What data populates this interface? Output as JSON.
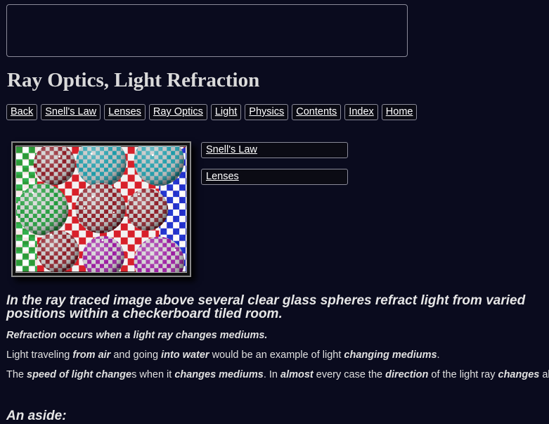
{
  "title": "Ray Optics, Light Refraction",
  "nav": [
    "Back",
    "Snell's Law",
    "Lenses",
    "Ray Optics",
    "Light",
    "Physics",
    "Contents",
    "Index",
    "Home"
  ],
  "side_links": [
    "Snell's Law",
    "Lenses"
  ],
  "caption": "In the ray traced image above several clear glass spheres refract light from varied positions within a checkerboard tiled room.",
  "p1": "Refraction occurs when a light ray changes mediums.",
  "p2": {
    "t1": "Light traveling ",
    "b1": "from air",
    "t2": " and going ",
    "b2": "into water",
    "t3": " would be an example of light ",
    "b3": "changing mediums",
    "t4": "."
  },
  "p3": {
    "t1": "The ",
    "b1": "speed of light change",
    "t2": "s when it ",
    "b2": "changes mediums",
    "t3": ". In ",
    "b3": "almost",
    "t4": " every case the ",
    "b4": "direction",
    "t5": " of the light ray ",
    "b5": "changes",
    "t6": " also."
  },
  "aside": "An aside:",
  "colors": {
    "background": "#0a0b1e",
    "text": "#e4e4e4",
    "link": "#ffffff",
    "border": "#8a8a99"
  }
}
